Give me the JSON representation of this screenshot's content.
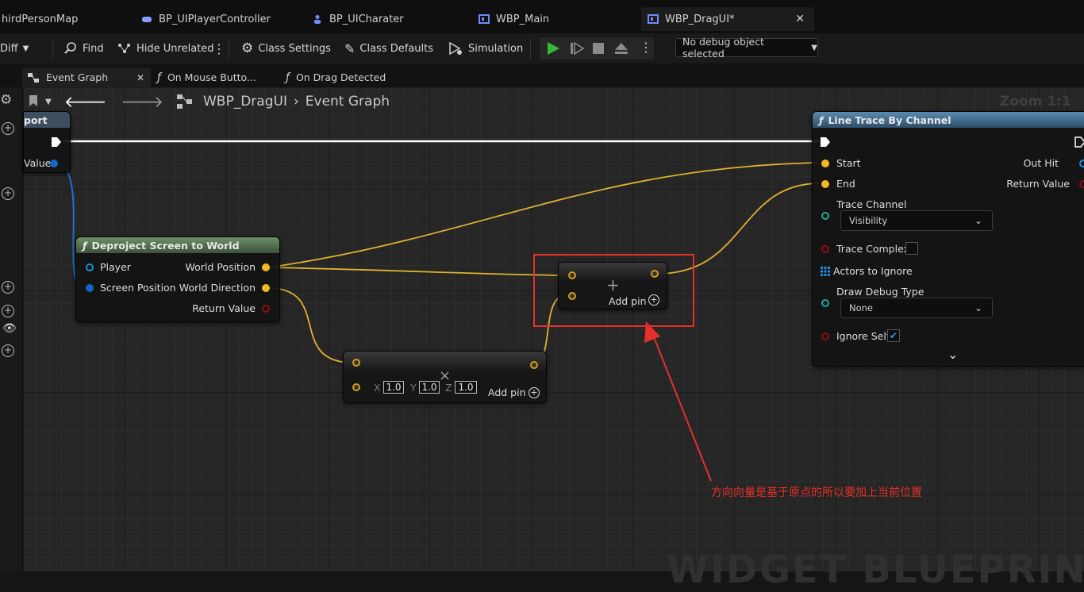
{
  "doc_tabs": [
    {
      "label": "hirdPersonMap",
      "active": false
    },
    {
      "label": "BP_UIPlayerController",
      "active": false
    },
    {
      "label": "BP_UICharater",
      "active": false
    },
    {
      "label": "WBP_Main",
      "active": false
    },
    {
      "label": "WBP_DragUI*",
      "active": true
    }
  ],
  "toolbar": {
    "diff": "Diff",
    "find": "Find",
    "hide_unrelated": "Hide Unrelated",
    "class_settings": "Class Settings",
    "class_defaults": "Class Defaults",
    "simulation": "Simulation",
    "debug_select": "No debug object selected"
  },
  "graph_tabs": [
    {
      "label": "Event Graph",
      "active": true
    },
    {
      "label": "On Mouse Butto...",
      "active": false
    },
    {
      "label": "On Drag Detected",
      "active": false
    }
  ],
  "breadcrumb": {
    "root": "WBP_DragUI",
    "current": "Event Graph"
  },
  "zoom": "Zoom 1:1",
  "watermark": "WIDGET BLUEPRINT",
  "nodes": {
    "left_partial": {
      "title": "port",
      "value_label": "Value"
    },
    "deproject": {
      "title": "Deproject Screen to World",
      "in_player": "Player",
      "in_screen_position": "Screen Position",
      "out_world_position": "World Position",
      "out_world_direction": "World Direction",
      "out_return": "Return Value"
    },
    "add": {
      "plus": "+",
      "add_pin": "Add pin"
    },
    "multiply": {
      "symbol": "×",
      "x_label": "X",
      "x": "1.0",
      "y_label": "Y",
      "y": "1.0",
      "z_label": "Z",
      "z": "1.0",
      "add_pin": "Add pin"
    },
    "line_trace": {
      "title": "Line Trace By Channel",
      "start": "Start",
      "end": "End",
      "out_hit": "Out Hit",
      "return_value": "Return Value",
      "trace_channel": "Trace Channel",
      "trace_channel_value": "Visibility",
      "trace_complex": "Trace Complex",
      "actors_to_ignore": "Actors to Ignore",
      "draw_debug_type": "Draw Debug Type",
      "draw_debug_value": "None",
      "ignore_self": "Ignore Self"
    }
  },
  "annotation": "方向向量是基于原点的所以要加上当前位置",
  "colors": {
    "exec": "#ffffff",
    "vector_wire": "#e1b030",
    "object_wire": "#1f6fd1",
    "annotation": "#e7302a",
    "func_header": "#5c7a56",
    "trace_header": "#3f6a86"
  }
}
